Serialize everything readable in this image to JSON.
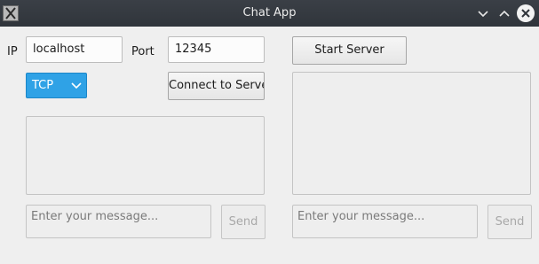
{
  "window": {
    "title": "Chat App",
    "icons": {
      "app": "x-app-icon",
      "minimize": "chevron-down-icon",
      "maximize": "chevron-up-icon",
      "close": "close-icon"
    }
  },
  "client": {
    "ip_label": "IP",
    "ip_value": "localhost",
    "port_label": "Port",
    "port_value": "12345",
    "protocol": "TCP",
    "connect_label": "Connect to Server",
    "message_placeholder": "Enter  your message...",
    "send_label": "Send"
  },
  "server": {
    "start_label": "Start Server",
    "message_placeholder": "Enter  your message...",
    "send_label": "Send"
  },
  "colors": {
    "titlebar": "#30353b",
    "combo_accent": "#2fa2e6",
    "window_bg": "#efefef"
  }
}
